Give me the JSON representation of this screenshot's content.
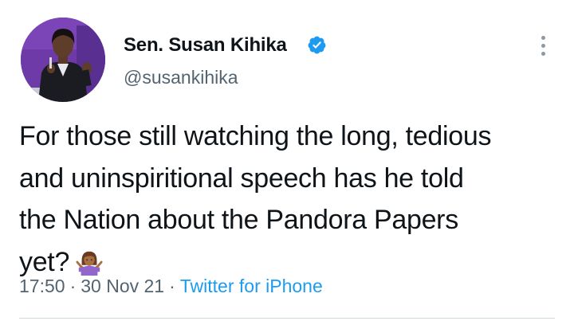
{
  "author": {
    "display_name": "Sen. Susan Kihika",
    "handle": "@susankihika",
    "verified": true,
    "avatar_icon": "profile-photo"
  },
  "tweet": {
    "text_lines": [
      "For those still watching the long, tedious",
      "and uninspiritional speech has he told",
      "the Nation about the Pandora Papers",
      "yet?"
    ],
    "emoji": "woman-shrugging-emoji"
  },
  "meta": {
    "time": "17:50",
    "separator": "·",
    "date": "30 Nov 21",
    "source": "Twitter for iPhone"
  },
  "colors": {
    "verified": "#1d9bf0",
    "link": "#1d9bf0",
    "secondary_text": "#536471"
  }
}
